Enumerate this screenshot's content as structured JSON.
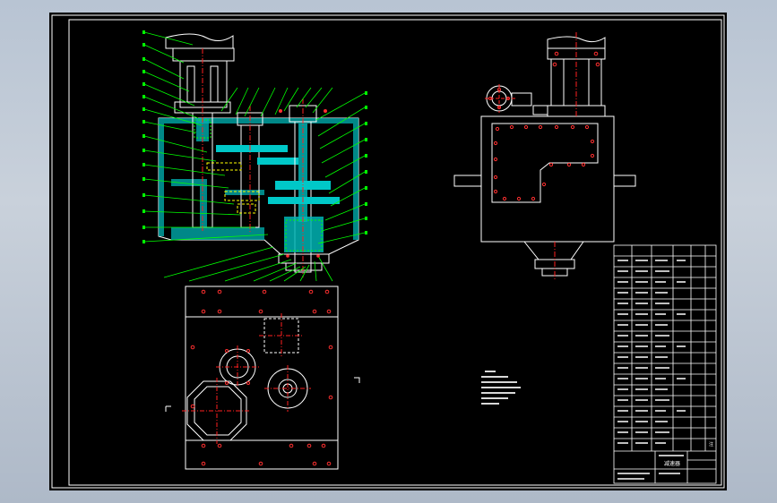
{
  "drawing": {
    "background": "#000000",
    "line_colors": {
      "outline": "#ffffff",
      "section_fill": "#00c8c8",
      "leader": "#00ff00",
      "center_line": "#ff2020",
      "hidden": "#ffff00"
    }
  },
  "title_block": {
    "label": "减速器",
    "remarks": "注"
  }
}
